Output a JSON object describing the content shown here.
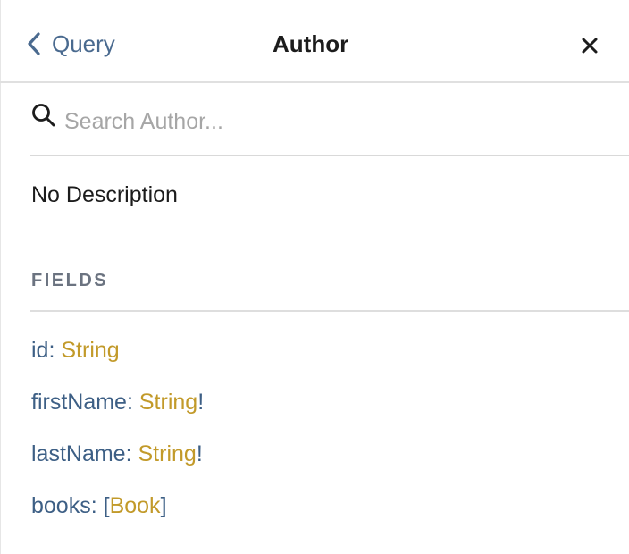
{
  "header": {
    "back_label": "Query",
    "title": "Author"
  },
  "search": {
    "placeholder": "Search Author..."
  },
  "description": "No Description",
  "fields_section": {
    "title": "FIELDS",
    "fields": [
      {
        "name": "id",
        "colon": ": ",
        "open": "",
        "type": "String",
        "close": ""
      },
      {
        "name": "firstName",
        "colon": ": ",
        "open": "",
        "type": "String",
        "close": "!"
      },
      {
        "name": "lastName",
        "colon": ": ",
        "open": "",
        "type": "String",
        "close": "!"
      },
      {
        "name": "books",
        "colon": ": ",
        "open": "[",
        "type": "Book",
        "close": "]"
      }
    ]
  },
  "colors": {
    "field_name": "#3d5f85",
    "type_name": "#c29a2a",
    "back_link": "#4a6a8f"
  },
  "icons": {
    "back": "chevron-left-icon",
    "close": "close-icon",
    "search": "search-icon"
  }
}
